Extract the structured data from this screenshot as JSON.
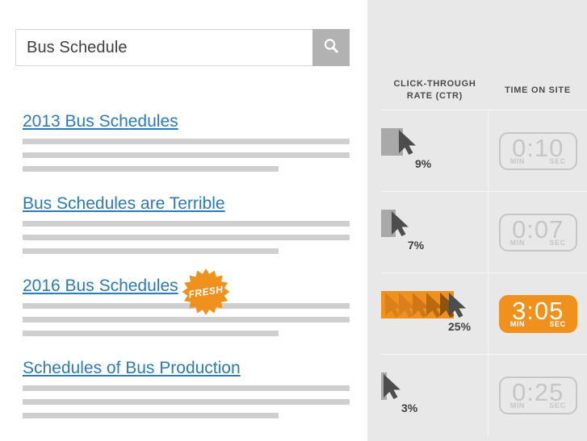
{
  "search": {
    "value": "Bus Schedule",
    "placeholder": "Search",
    "button_icon": "search-icon"
  },
  "results": [
    {
      "title": "2013 Bus Schedules",
      "badge": null
    },
    {
      "title": "Bus Schedules are Terrible",
      "badge": null
    },
    {
      "title": "2016 Bus Schedules",
      "badge": "FRESH"
    },
    {
      "title": "Schedules of Bus Production",
      "badge": null
    }
  ],
  "metrics": {
    "columns": [
      {
        "label_line1": "CLICK-THROUGH",
        "label_line2": "RATE (CTR)"
      },
      {
        "label_line1": "TIME ON SITE",
        "label_line2": ""
      }
    ],
    "units": {
      "min": "MIN",
      "sec": "SEC"
    },
    "rows": [
      {
        "ctr": "9%",
        "ctr_value": 9,
        "time": "0:10",
        "highlighted": false
      },
      {
        "ctr": "7%",
        "ctr_value": 7,
        "time": "0:07",
        "highlighted": false
      },
      {
        "ctr": "25%",
        "ctr_value": 25,
        "time": "3:05",
        "highlighted": true
      },
      {
        "ctr": "3%",
        "ctr_value": 3,
        "time": "0:25",
        "highlighted": false
      }
    ]
  },
  "colors": {
    "accent_orange": "#f0911e",
    "orange_dark": "#d9801a",
    "link_blue": "#2b7bb9",
    "bar_gray": "#a9a9a9",
    "cursor_gray": "#4d4d4d",
    "panel_gray": "#e8e8e8",
    "line_gray": "#cfcfcf",
    "timer_outline": "#c6c6c6"
  }
}
